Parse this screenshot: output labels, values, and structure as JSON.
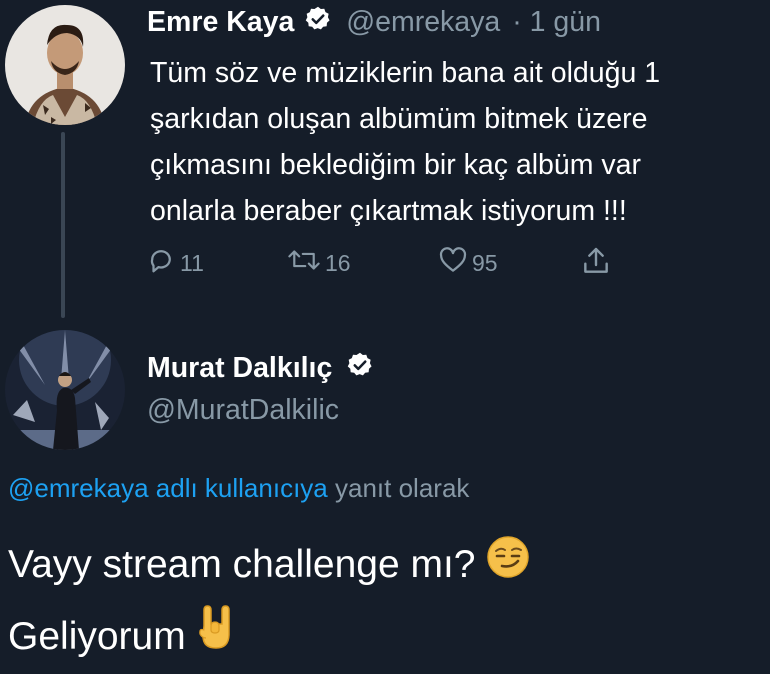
{
  "tweet": {
    "author_name": "Emre Kaya",
    "author_handle": "@emrekaya",
    "time": "· 1 gün",
    "lines": [
      "Tüm söz ve müziklerin bana ait olduğu 1",
      "şarkıdan oluşan albümüm bitmek üzere",
      "çıkmasını beklediğim bir kaç albüm var",
      "onlarla beraber çıkartmak istiyorum !!!"
    ],
    "reply_count": "11",
    "retweet_count": "16",
    "like_count": "95"
  },
  "reply": {
    "author_name": "Murat Dalkılıç",
    "author_handle": "@MuratDalkilic",
    "context_link": "@emrekaya adlı kullanıcıya",
    "context_suffix": "yanıt olarak",
    "line1": "Vayy stream challenge mı?",
    "line2": "Geliyorum"
  },
  "colors": {
    "background": "#151d29",
    "link": "#1da1f2",
    "muted": "#8899a6",
    "verified_badge": "#ffffff"
  },
  "icons": [
    "reply-icon",
    "retweet-icon",
    "like-icon",
    "share-icon",
    "verified-icon",
    "smirk-emoji",
    "rock-hand-emoji"
  ]
}
